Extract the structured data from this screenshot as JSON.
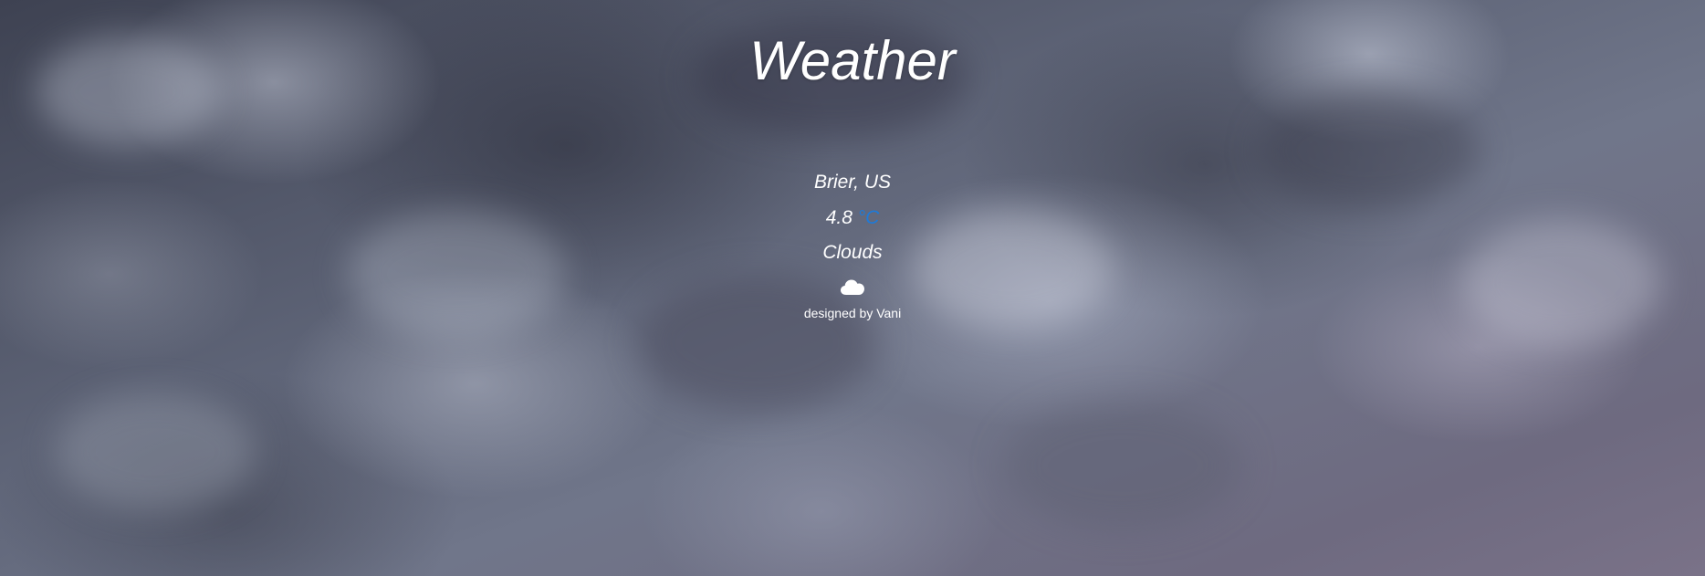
{
  "page": {
    "title": "Weather",
    "background_scene": "storm-clouds"
  },
  "weather": {
    "location": "Brier, US",
    "temperature": "4.8",
    "unit_label": "°C",
    "condition": "Clouds",
    "condition_icon": "cloud-icon"
  },
  "footer": {
    "credit": "designed by Vani"
  },
  "colors": {
    "unit_link": "#1e7ad8",
    "text": "#ffffff"
  }
}
